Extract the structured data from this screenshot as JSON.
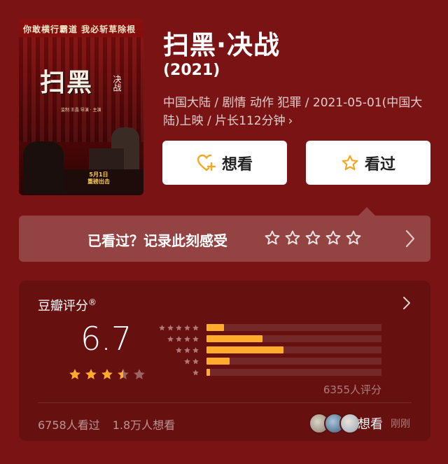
{
  "poster": {
    "tagline": "你敢横行霸道  我必斩草除根",
    "title": "扫黑",
    "subtitle": "决战",
    "credits": "监制 王晶   导演 · 主演",
    "date_line1": "5月1日",
    "date_line2": "重磅出击"
  },
  "movie": {
    "title": "扫黑·决战",
    "year": "(2021)",
    "meta": "中国大陆 / 剧情 动作 犯罪 / 2021-05-01(中国大陆)上映 / 片长112分钟",
    "meta_chevron": "›"
  },
  "actions": {
    "want_label": "想看",
    "seen_label": "看过",
    "want_icon": "heart-plus-icon",
    "seen_icon": "star-outline-icon",
    "accent": "#f5a623"
  },
  "record": {
    "label": "已看过？记录此刻感受",
    "stars": 5
  },
  "rating": {
    "title": "豆瓣评分",
    "trademark": "®",
    "score": "6.7",
    "stars_value": 3.5,
    "distribution": [
      {
        "stars": 5,
        "fraction": 0.1
      },
      {
        "stars": 4,
        "fraction": 0.32
      },
      {
        "stars": 3,
        "fraction": 0.44
      },
      {
        "stars": 2,
        "fraction": 0.13
      },
      {
        "stars": 1,
        "fraction": 0.02
      }
    ],
    "count": "6355人评分",
    "seen_count": "6758人看过",
    "want_count": "1.8万人想看",
    "footer_want": "想看",
    "footer_time": "刚刚",
    "bar_color": "#ffac2d",
    "star_color": "#ffac2d"
  }
}
